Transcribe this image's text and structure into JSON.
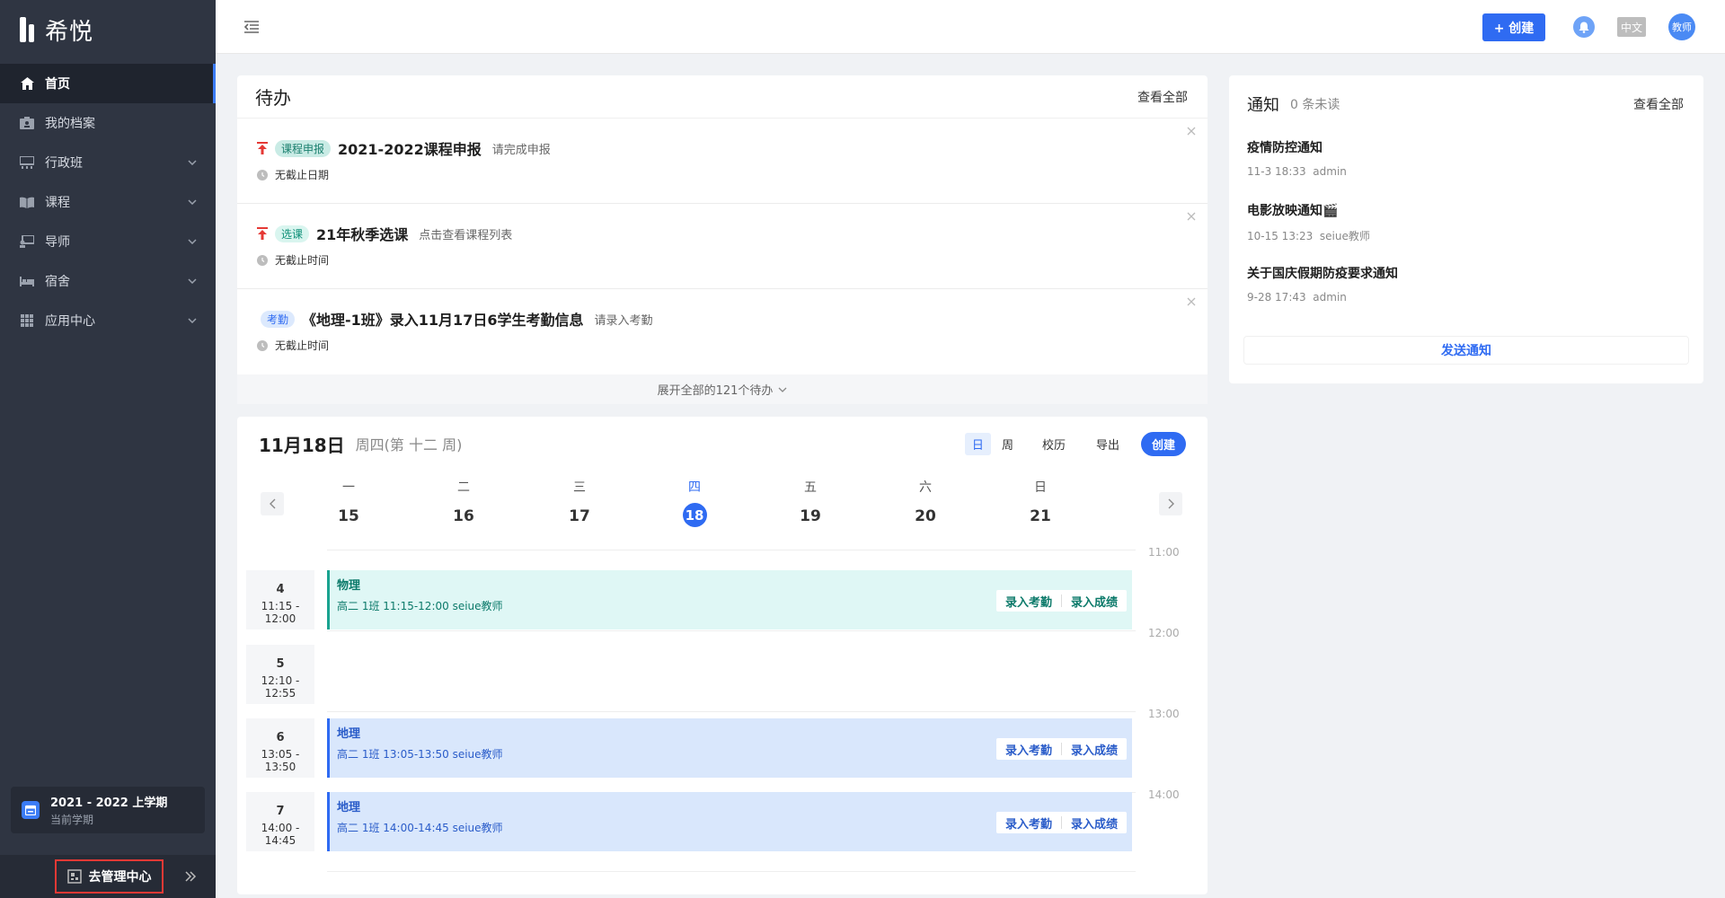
{
  "app": {
    "logo_text": "希悦"
  },
  "sidebar": {
    "items": [
      {
        "label": "首页",
        "icon": "home-icon",
        "active": true
      },
      {
        "label": "我的档案",
        "icon": "profile-icon"
      },
      {
        "label": "行政班",
        "icon": "class-icon"
      },
      {
        "label": "课程",
        "icon": "book-icon"
      },
      {
        "label": "导师",
        "icon": "mentor-icon"
      },
      {
        "label": "宿舍",
        "icon": "bed-icon"
      },
      {
        "label": "应用中心",
        "icon": "apps-icon"
      }
    ],
    "term": {
      "title": "2021 - 2022 上学期",
      "subtitle": "当前学期"
    },
    "admin_label": "去管理中心"
  },
  "header": {
    "create_label": "+ 创建",
    "lang_label": "中文",
    "avatar_label": "教师"
  },
  "todo": {
    "title": "待办",
    "view_all": "查看全部",
    "items": [
      {
        "tag": "课程申报",
        "title": "2021-2022课程申报",
        "hint": "请完成申报",
        "deadline": "无截止日期"
      },
      {
        "tag": "选课",
        "title": "21年秋季选课",
        "hint": "点击查看课程列表",
        "deadline": "无截止时间"
      },
      {
        "tag": "考勤",
        "title": "《地理-1班》录入11月17日6学生考勤信息",
        "hint": "请录入考勤",
        "deadline": "无截止时间"
      }
    ],
    "expand_label": "展开全部的121个待办"
  },
  "notice": {
    "title": "通知",
    "unread": "0 条未读",
    "view_all": "查看全部",
    "items": [
      {
        "title": "疫情防控通知",
        "time": "11-3 18:33",
        "author": "admin"
      },
      {
        "title": "电影放映通知🎬",
        "time": "10-15 13:23",
        "author": "seiue教师"
      },
      {
        "title": "关于国庆假期防疫要求通知",
        "time": "9-28 17:43",
        "author": "admin"
      }
    ],
    "send_label": "发送通知"
  },
  "schedule": {
    "date": "11月18日",
    "week_info": "周四(第 十二 周)",
    "views": {
      "day": "日",
      "week": "周",
      "calendar": "校历",
      "export": "导出",
      "create": "创建"
    },
    "days": [
      {
        "name": "一",
        "num": "15"
      },
      {
        "name": "二",
        "num": "16"
      },
      {
        "name": "三",
        "num": "17"
      },
      {
        "name": "四",
        "num": "18",
        "today": true
      },
      {
        "name": "五",
        "num": "19"
      },
      {
        "name": "六",
        "num": "20"
      },
      {
        "name": "日",
        "num": "21"
      }
    ],
    "times": [
      "11:00",
      "12:00",
      "13:00",
      "14:00"
    ],
    "periods": [
      {
        "num": "4",
        "time": "11:15 - 12:00"
      },
      {
        "num": "5",
        "time": "12:10 - 12:55"
      },
      {
        "num": "6",
        "time": "13:05 - 13:50"
      },
      {
        "num": "7",
        "time": "14:00 - 14:45"
      }
    ],
    "events": [
      {
        "title": "物理",
        "info": "高二  1班  11:15-12:00  seiue教师",
        "color": "teal"
      },
      {
        "title": "地理",
        "info": "高二  1班  13:05-13:50  seiue教师",
        "color": "blue"
      },
      {
        "title": "地理",
        "info": "高二  1班  14:00-14:45  seiue教师",
        "color": "blue"
      }
    ],
    "action_attendance": "录入考勤",
    "action_score": "录入成绩"
  },
  "colors": {
    "primary": "#2f6bf2",
    "sidebar_bg": "#2f3542",
    "teal": "#1aa390"
  }
}
